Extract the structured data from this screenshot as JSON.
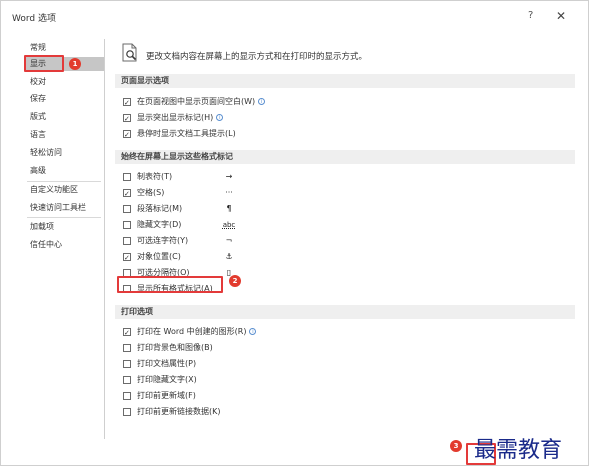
{
  "window": {
    "title": "Word 选项",
    "help": "?",
    "close": "✕"
  },
  "sidebar": {
    "items": [
      {
        "label": "常规"
      },
      {
        "label": "显示",
        "selected": true
      },
      {
        "label": "校对"
      },
      {
        "label": "保存"
      },
      {
        "label": "版式"
      },
      {
        "label": "语言"
      },
      {
        "label": "轻松访问"
      },
      {
        "label": "高级"
      },
      {
        "label": "自定义功能区"
      },
      {
        "label": "快速访问工具栏"
      },
      {
        "label": "加载项"
      },
      {
        "label": "信任中心"
      }
    ]
  },
  "badges": [
    "1",
    "2",
    "3"
  ],
  "main": {
    "intro": "更改文档内容在屏幕上的显示方式和在打印时的显示方式。",
    "page_display": {
      "header": "页面显示选项",
      "options": [
        {
          "label": "在页面视图中显示页面间空白(W)",
          "checked": true,
          "info": true
        },
        {
          "label": "显示突出显示标记(H)",
          "checked": true,
          "info": true
        },
        {
          "label": "悬停时显示文档工具提示(L)",
          "checked": true,
          "info": false
        }
      ]
    },
    "formatting_marks": {
      "header": "始终在屏幕上显示这些格式标记",
      "options": [
        {
          "label": "制表符(T)",
          "checked": false,
          "symbol": "→"
        },
        {
          "label": "空格(S)",
          "checked": true,
          "symbol": "···"
        },
        {
          "label": "段落标记(M)",
          "checked": false,
          "symbol": "¶"
        },
        {
          "label": "隐藏文字(D)",
          "checked": false,
          "symbol": "abc"
        },
        {
          "label": "可选连字符(Y)",
          "checked": false,
          "symbol": "¬"
        },
        {
          "label": "对象位置(C)",
          "checked": true,
          "symbol": "⚓"
        },
        {
          "label": "可选分隔符(O)",
          "checked": false,
          "symbol": "▯"
        },
        {
          "label": "显示所有格式标记(A)",
          "checked": false,
          "symbol": ""
        }
      ]
    },
    "print": {
      "header": "打印选项",
      "options": [
        {
          "label": "打印在 Word 中创建的图形(R)",
          "checked": true,
          "info": true
        },
        {
          "label": "打印背景色和图像(B)",
          "checked": false,
          "info": false
        },
        {
          "label": "打印文档属性(P)",
          "checked": false,
          "info": false
        },
        {
          "label": "打印隐藏文字(X)",
          "checked": false,
          "info": false
        },
        {
          "label": "打印前更新域(F)",
          "checked": false,
          "info": false
        },
        {
          "label": "打印前更新链接数据(K)",
          "checked": false,
          "info": false
        }
      ]
    }
  },
  "watermark": "最需教育",
  "colors": {
    "annotation_red": "#e33a3a",
    "selected_nav": "#c6c6c6",
    "section_bg": "#efefef",
    "watermark": "#1a2a8a"
  }
}
